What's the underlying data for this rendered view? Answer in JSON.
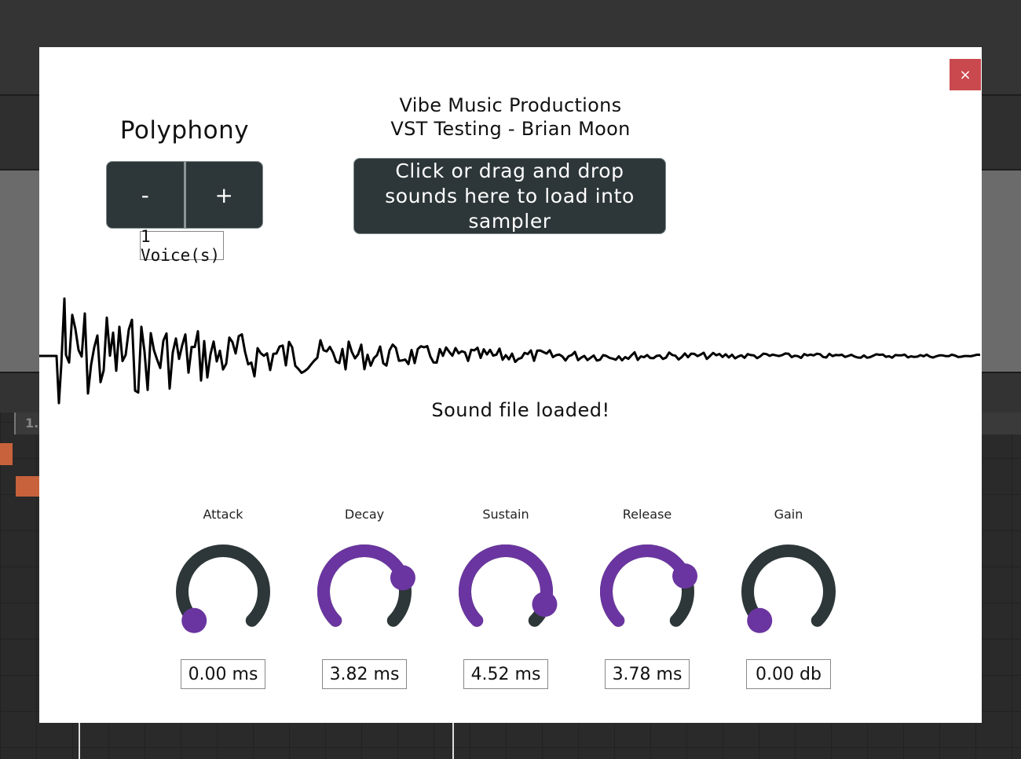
{
  "background": {
    "ruler_marker": "1."
  },
  "dialog": {
    "close_label": "×",
    "polyphony": {
      "title": "Polyphony",
      "minus_label": "-",
      "plus_label": "+",
      "voices": "1 Voice(s)"
    },
    "header": {
      "line1": "Vibe Music Productions",
      "line2": "VST Testing - Brian Moon"
    },
    "drop_zone_label": "Click or drag and drop sounds here to load into sampler",
    "status": "Sound file loaded!",
    "knobs": [
      {
        "label": "Attack",
        "value": "0.00 ms",
        "level": 0.0
      },
      {
        "label": "Decay",
        "value": "3.82 ms",
        "level": 0.76
      },
      {
        "label": "Sustain",
        "value": "4.52 ms",
        "level": 0.9
      },
      {
        "label": "Release",
        "value": "3.78 ms",
        "level": 0.75
      },
      {
        "label": "Gain",
        "value": "0.00 db",
        "level": 0.0
      }
    ],
    "colors": {
      "close": "#c9494f",
      "button_bg": "#2d3638",
      "knob_track": "#2d3638",
      "knob_accent": "#6a35a0"
    }
  }
}
